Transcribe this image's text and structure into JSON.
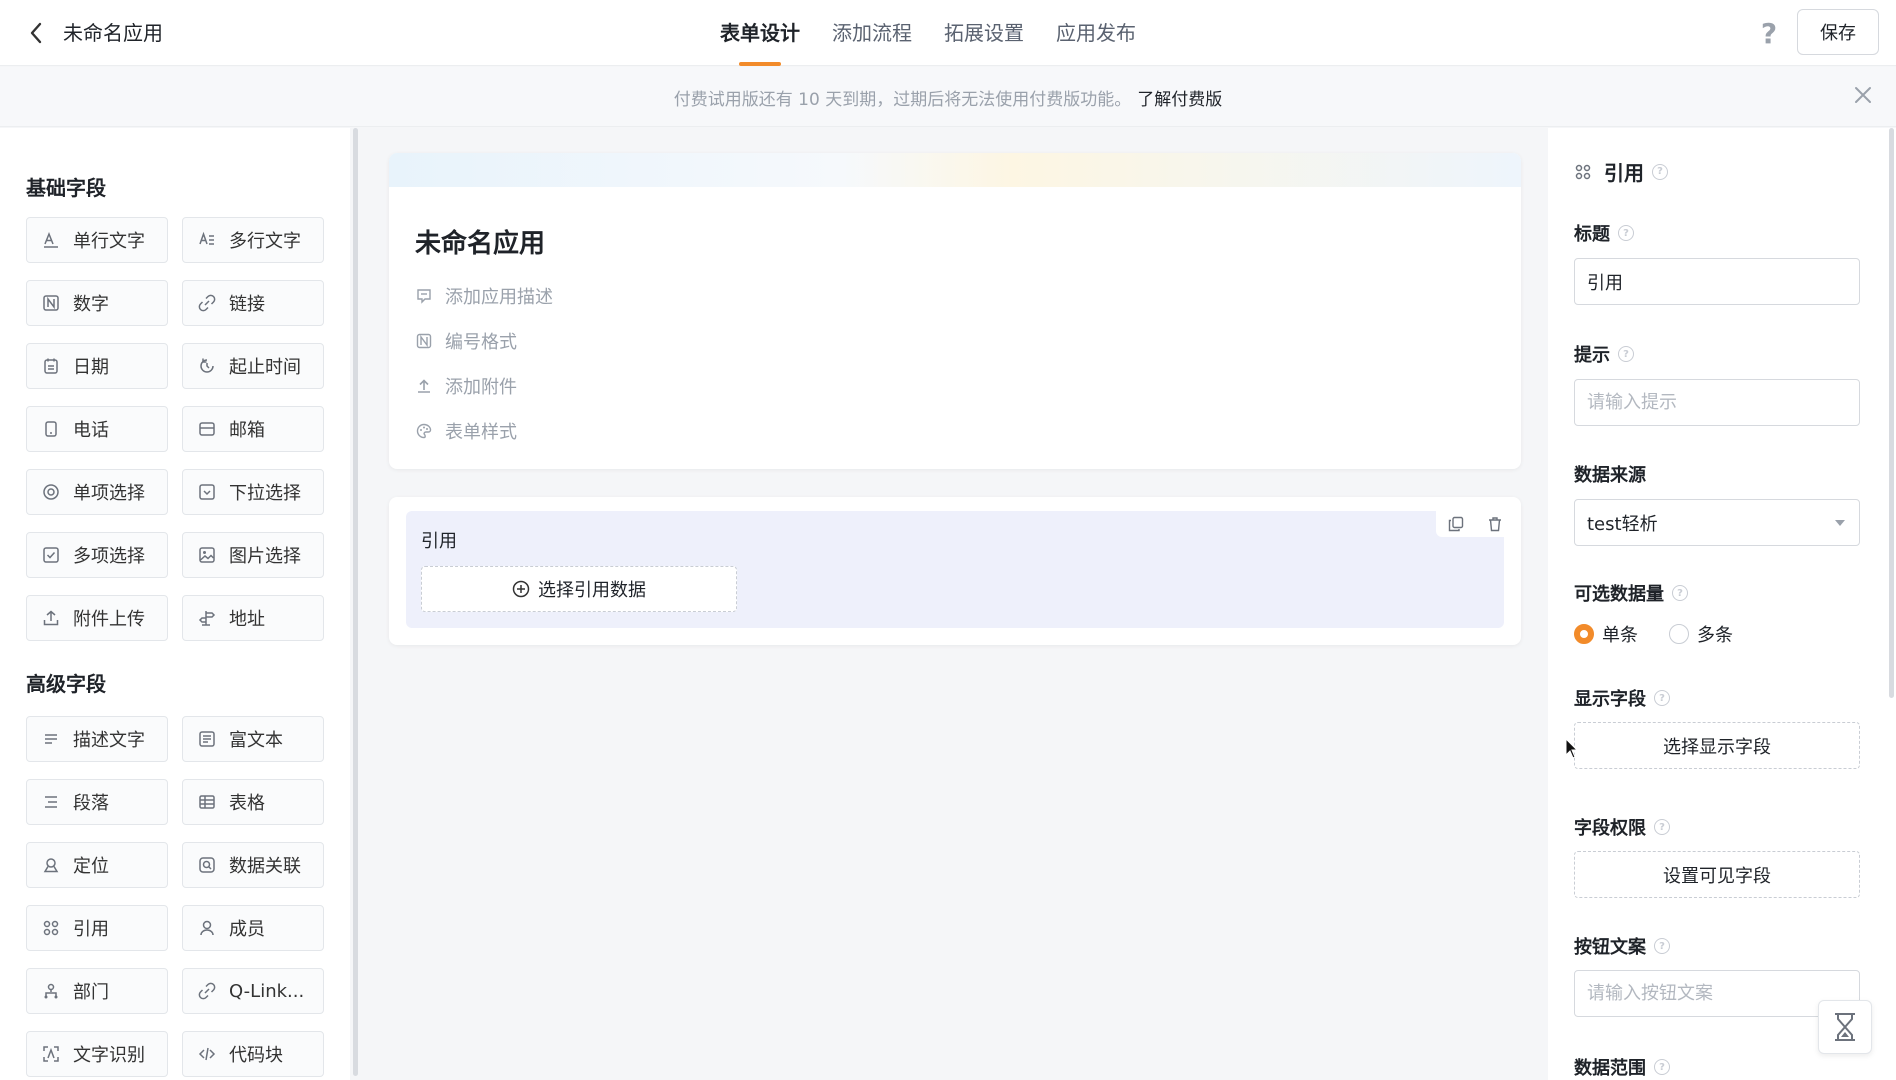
{
  "header": {
    "app_name": "未命名应用",
    "tabs": [
      {
        "label": "表单设计",
        "active": true
      },
      {
        "label": "添加流程",
        "active": false
      },
      {
        "label": "拓展设置",
        "active": false
      },
      {
        "label": "应用发布",
        "active": false
      }
    ],
    "help_icon": "?",
    "save_label": "保存"
  },
  "banner": {
    "text": "付费试用版还有 10 天到期，过期后将无法使用付费版功能。",
    "link": "了解付费版"
  },
  "left_panel": {
    "basic_title": "基础字段",
    "basic_fields": [
      {
        "label": "单行文字",
        "icon": "text-icon"
      },
      {
        "label": "多行文字",
        "icon": "multiline-text-icon"
      },
      {
        "label": "数字",
        "icon": "number-icon"
      },
      {
        "label": "链接",
        "icon": "link-icon"
      },
      {
        "label": "日期",
        "icon": "calendar-icon"
      },
      {
        "label": "起止时间",
        "icon": "time-range-icon"
      },
      {
        "label": "电话",
        "icon": "phone-icon"
      },
      {
        "label": "邮箱",
        "icon": "mail-icon"
      },
      {
        "label": "单项选择",
        "icon": "radio-icon"
      },
      {
        "label": "下拉选择",
        "icon": "dropdown-icon"
      },
      {
        "label": "多项选择",
        "icon": "checkbox-icon"
      },
      {
        "label": "图片选择",
        "icon": "image-icon"
      },
      {
        "label": "附件上传",
        "icon": "upload-icon"
      },
      {
        "label": "地址",
        "icon": "signpost-icon"
      }
    ],
    "advanced_title": "高级字段",
    "advanced_fields": [
      {
        "label": "描述文字",
        "icon": "description-icon"
      },
      {
        "label": "富文本",
        "icon": "rich-text-icon"
      },
      {
        "label": "段落",
        "icon": "paragraph-icon"
      },
      {
        "label": "表格",
        "icon": "table-icon"
      },
      {
        "label": "定位",
        "icon": "location-icon"
      },
      {
        "label": "数据关联",
        "icon": "data-link-icon"
      },
      {
        "label": "引用",
        "icon": "reference-icon"
      },
      {
        "label": "成员",
        "icon": "member-icon"
      },
      {
        "label": "部门",
        "icon": "department-icon"
      },
      {
        "label": "Q-Link...",
        "icon": "qlink-icon"
      },
      {
        "label": "文字识别",
        "icon": "ocr-icon"
      },
      {
        "label": "代码块",
        "icon": "code-icon"
      }
    ]
  },
  "form": {
    "title": "未命名应用",
    "options": [
      {
        "label": "添加应用描述",
        "icon": "comment-icon"
      },
      {
        "label": "编号格式",
        "icon": "number-format-icon"
      },
      {
        "label": "添加附件",
        "icon": "upload-icon"
      },
      {
        "label": "表单样式",
        "icon": "palette-icon"
      }
    ],
    "reference_field": {
      "label": "引用",
      "select_button": "选择引用数据"
    }
  },
  "right_panel": {
    "header": "引用",
    "title_label": "标题",
    "title_value": "引用",
    "hint_label": "提示",
    "hint_placeholder": "请输入提示",
    "source_label": "数据来源",
    "source_value": "test轻析",
    "quantity_label": "可选数据量",
    "quantity_options": [
      {
        "label": "单条",
        "checked": true
      },
      {
        "label": "多条",
        "checked": false
      }
    ],
    "display_label": "显示字段",
    "display_button": "选择显示字段",
    "permission_label": "字段权限",
    "permission_button": "设置可见字段",
    "button_text_label": "按钮文案",
    "button_text_placeholder": "请输入按钮文案",
    "range_label": "数据范围"
  },
  "colors": {
    "accent": "#f28b2a",
    "reference_bg": "#eef0fb"
  }
}
